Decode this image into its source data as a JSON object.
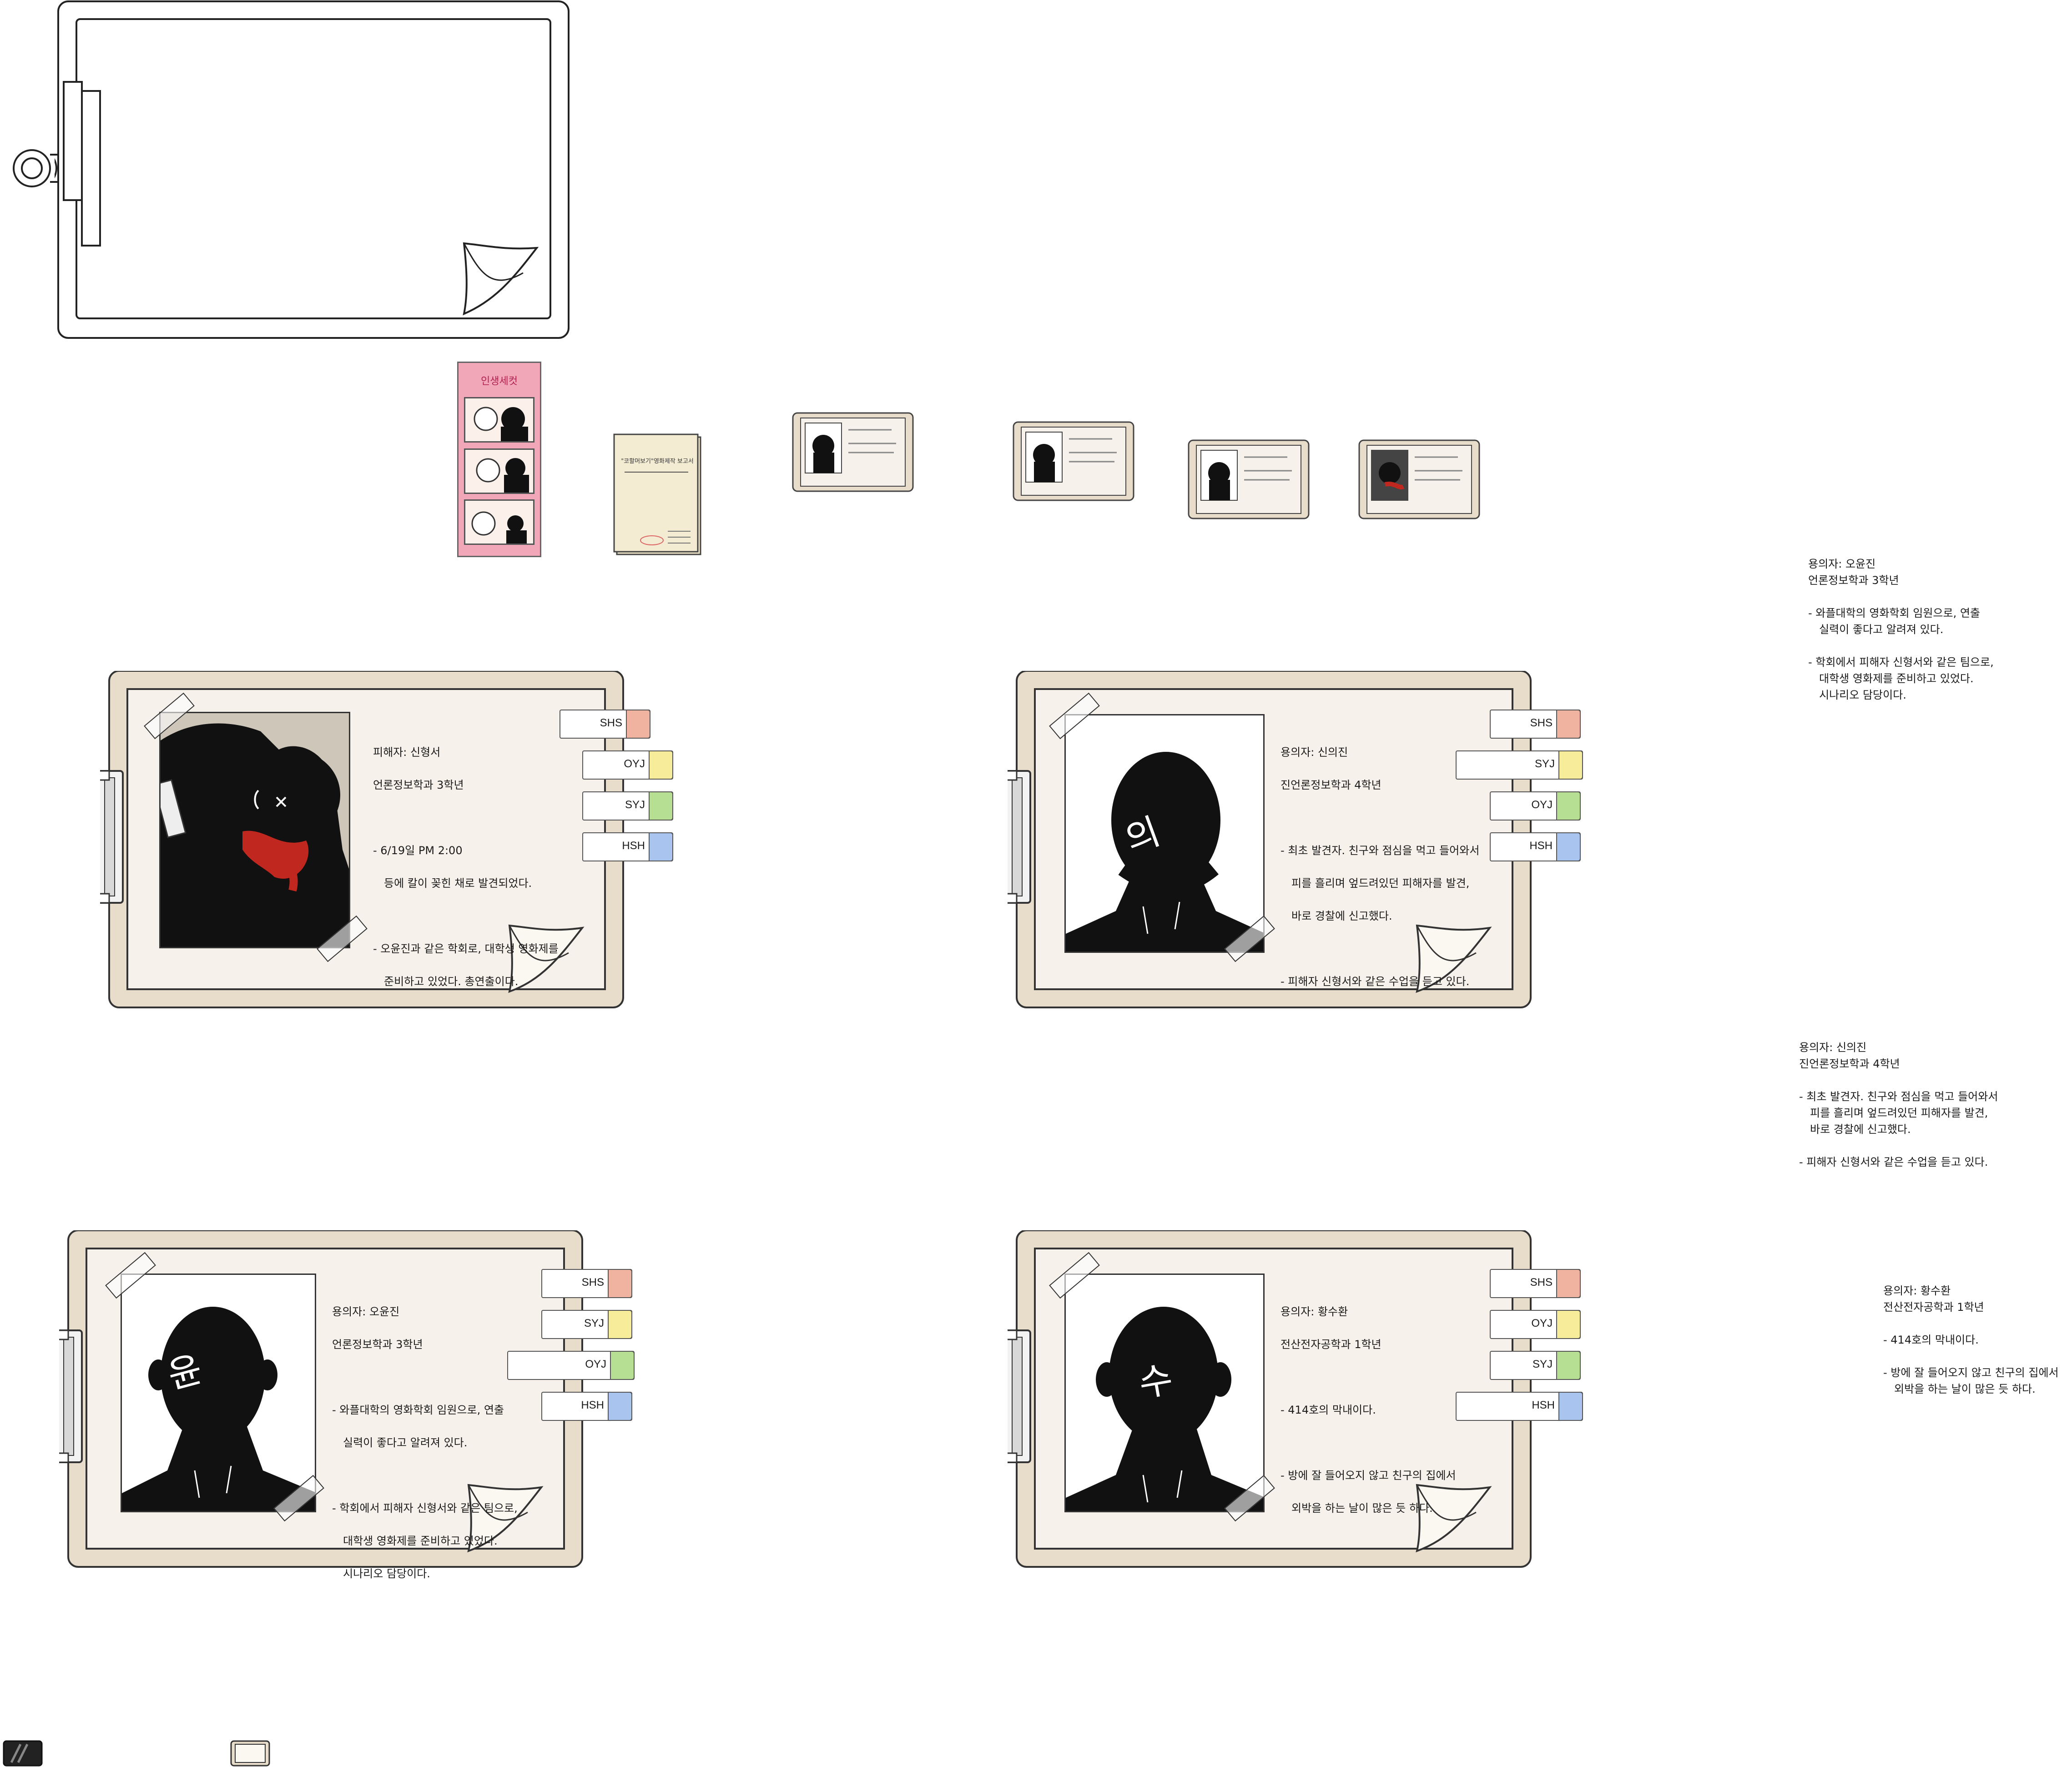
{
  "photostrip": {
    "title": "인생세컷"
  },
  "report": {
    "title": "\"코할머보기\"영화제작 보고서"
  },
  "tabs": {
    "shs": "SHS",
    "oyj": "OYJ",
    "syj": "SYJ",
    "hsh": "HSH",
    "colors": {
      "shs": "#f0b39f",
      "oyj": "#f7ec9a",
      "syj": "#b7df93",
      "hsh": "#a8c4ef"
    }
  },
  "cards": {
    "victim": {
      "name": "피해자: 신형서",
      "dept": "언론정보학과 3학년",
      "p1a": "- 6/19일 PM 2:00",
      "p1b": "등에 칼이 꽂힌 채로 발견되었다.",
      "p2a": "- 오윤진과 같은 학회로, 대학생 영화제를",
      "p2b": "준비하고 있었다. 총연출이다."
    },
    "syj": {
      "name": "용의자: 신의진",
      "dept": "진언론정보학과 4학년",
      "p1a": "- 최초 발견자. 친구와 점심을 먹고 들어와서",
      "p1b": "피를 흘리며 엎드려있던 피해자를 발견,",
      "p1c": "바로 경찰에 신고했다.",
      "p2a": "- 피해자 신형서와 같은 수업을 듣고 있다.",
      "face_char": "의"
    },
    "oyj": {
      "name": "용의자: 오윤진",
      "dept": "언론정보학과 3학년",
      "p1a": "- 와플대학의 영화학회 임원으로, 연출",
      "p1b": "실력이 좋다고 알려져 있다.",
      "p2a": "- 학회에서 피해자 신형서와 같은 팀으로,",
      "p2b": "대학생 영화제를 준비하고 있었다.",
      "p2c": "시나리오 담당이다.",
      "face_char": "윤"
    },
    "hsh": {
      "name": "용의자: 황수환",
      "dept": "전산전자공학과 1학년",
      "p1a": "- 414호의 막내이다.",
      "p2a": "- 방에 잘 들어오지 않고 친구의 집에서",
      "p2b": "외박을 하는 날이 많은 듯 하다.",
      "face_char": "수"
    }
  },
  "notes": {
    "oyj": {
      "name": "용의자: 오윤진",
      "dept": "언론정보학과 3학년",
      "p1a": "- 와플대학의 영화학회 임원으로, 연출",
      "p1b": "실력이 좋다고 알려져 있다.",
      "p2a": "- 학회에서 피해자 신형서와 같은 팀으로,",
      "p2b": "대학생 영화제를 준비하고 있었다.",
      "p2c": "시나리오 담당이다."
    },
    "syj": {
      "name": "용의자: 신의진",
      "dept": "진언론정보학과 4학년",
      "p1a": "- 최초 발견자. 친구와 점심을 먹고 들어와서",
      "p1b": "피를 흘리며 엎드려있던 피해자를 발견,",
      "p1c": "바로 경찰에 신고했다.",
      "p2a": "- 피해자 신형서와 같은 수업을 듣고 있다."
    },
    "hsh": {
      "name": "용의자: 황수환",
      "dept": "전산전자공학과 1학년",
      "p1a": "- 414호의 막내이다.",
      "p2a": "- 방에 잘 들어오지 않고 친구의 집에서",
      "p2b": "외박을 하는 날이 많은 듯 하다."
    }
  },
  "colors": {
    "clipboard": "#e8dccb",
    "paper": "#f6f1ea",
    "blood": "#c0281f",
    "photostrip": "#f2a7b8"
  }
}
